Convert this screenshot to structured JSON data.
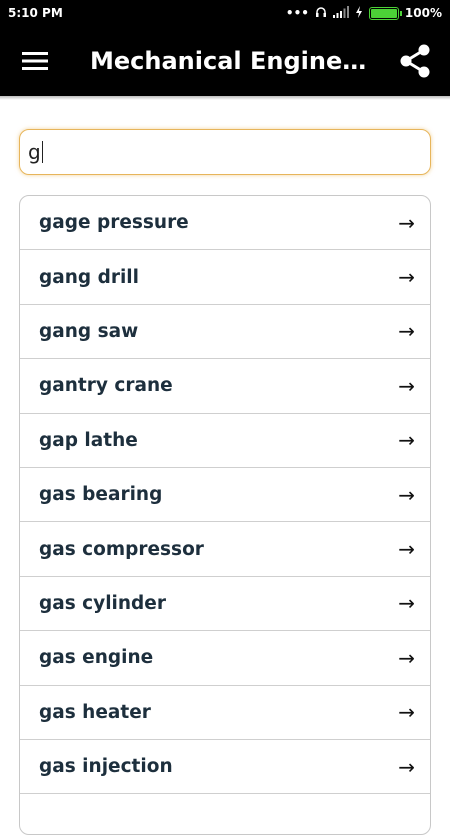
{
  "status_bar": {
    "time": "5:10 PM",
    "battery": "100%",
    "battery_level": 1.0,
    "icons": [
      "dots-icon",
      "headphones-icon",
      "signal-icon",
      "charging-icon",
      "battery-icon"
    ]
  },
  "app_bar": {
    "title": "Mechanical Engineerin…",
    "menu_icon": "hamburger-menu-icon",
    "share_icon": "share-icon"
  },
  "search": {
    "value": "g",
    "accent_color": "#e7b55a"
  },
  "results": [
    {
      "label": "gage pressure",
      "icon": "arrow-right-icon"
    },
    {
      "label": "gang drill",
      "icon": "arrow-right-icon"
    },
    {
      "label": "gang saw",
      "icon": "arrow-right-icon"
    },
    {
      "label": "gantry crane",
      "icon": "arrow-right-icon"
    },
    {
      "label": "gap lathe",
      "icon": "arrow-right-icon"
    },
    {
      "label": "gas bearing",
      "icon": "arrow-right-icon"
    },
    {
      "label": "gas compressor",
      "icon": "arrow-right-icon"
    },
    {
      "label": "gas cylinder",
      "icon": "arrow-right-icon"
    },
    {
      "label": "gas engine",
      "icon": "arrow-right-icon"
    },
    {
      "label": "gas heater",
      "icon": "arrow-right-icon"
    },
    {
      "label": "gas injection",
      "icon": "arrow-right-icon"
    },
    {
      "label": "",
      "icon": ""
    }
  ],
  "arrow_glyph": "→"
}
